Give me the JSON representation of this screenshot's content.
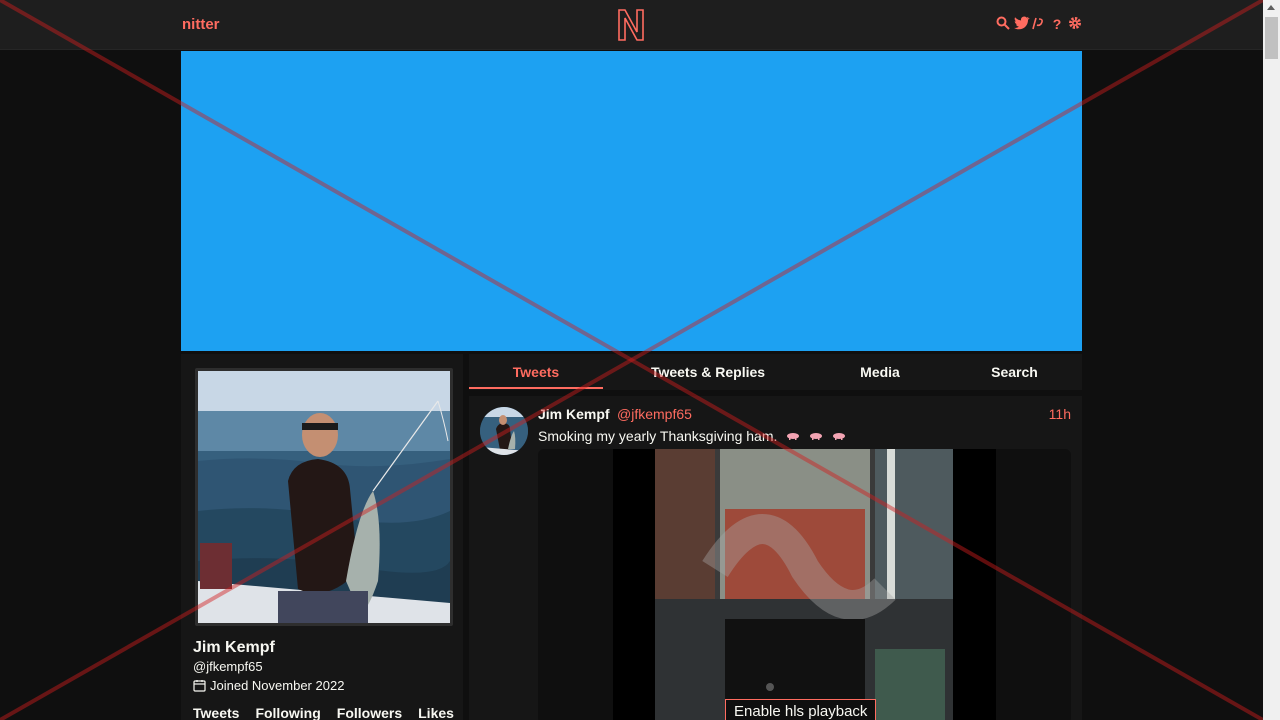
{
  "nav": {
    "logo_text": "nitter",
    "icons": [
      "search-icon",
      "twitter-icon",
      "rss-icon",
      "help-icon",
      "settings-icon"
    ]
  },
  "profile": {
    "name": "Jim Kempf",
    "handle": "@jfkempf65",
    "joined": "Joined November 2022",
    "stats": [
      "Tweets",
      "Following",
      "Followers",
      "Likes"
    ]
  },
  "tabs": [
    "Tweets",
    "Tweets & Replies",
    "Media",
    "Search"
  ],
  "tweet": {
    "name": "Jim Kempf",
    "handle": "@jfkempf65",
    "time": "11h",
    "text": "Smoking my yearly Thanksgiving ham.",
    "hls_button": "Enable hls playback"
  },
  "colors": {
    "accent": "#ff6c60",
    "banner": "#1da1f2",
    "background": "#0f0f0f",
    "panel": "#161616"
  }
}
